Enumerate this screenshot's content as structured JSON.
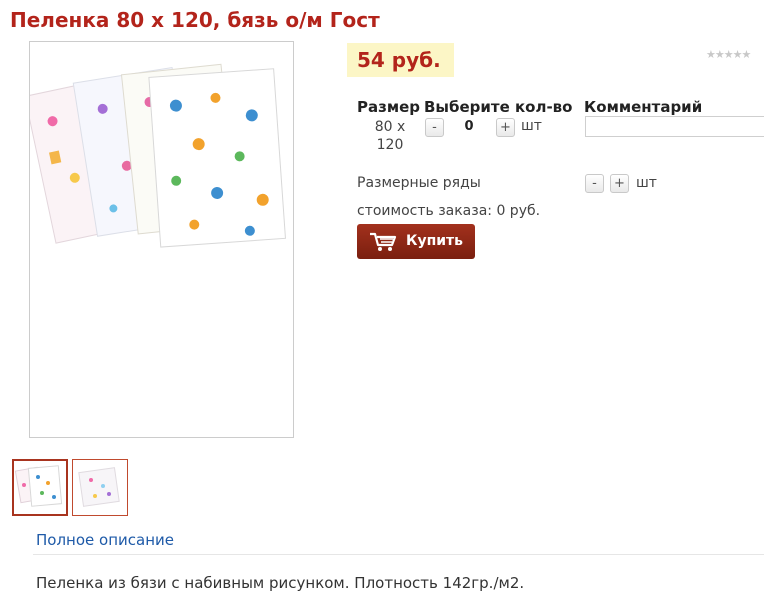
{
  "product": {
    "title": "Пеленка 80 х 120, бязь о/м Гост",
    "price": "54 руб.",
    "rating_stars": "★★★★★"
  },
  "table": {
    "headers": {
      "size": "Размер",
      "qty": "Выберите кол-во",
      "comment": "Комментарий"
    },
    "row": {
      "size": "80 х 120",
      "minus": "-",
      "qty": "0",
      "plus": "+",
      "unit": "шт",
      "comment": ""
    }
  },
  "size_rows": {
    "label": "Размерные ряды",
    "minus": "-",
    "plus": "+",
    "unit": "шт"
  },
  "order_cost": "стоимость заказа: 0 руб.",
  "buy_button": {
    "label": "Купить",
    "icon": "cart-icon"
  },
  "description": {
    "link": "Полное описание",
    "text": "Пеленка из бязи с набивным рисунком. Плотность 142гр./м2."
  },
  "colors": {
    "title": "#b3241b",
    "price_bg": "#fcf6c6",
    "buy_button": "#8e2a17",
    "link": "#1e5aa8"
  }
}
